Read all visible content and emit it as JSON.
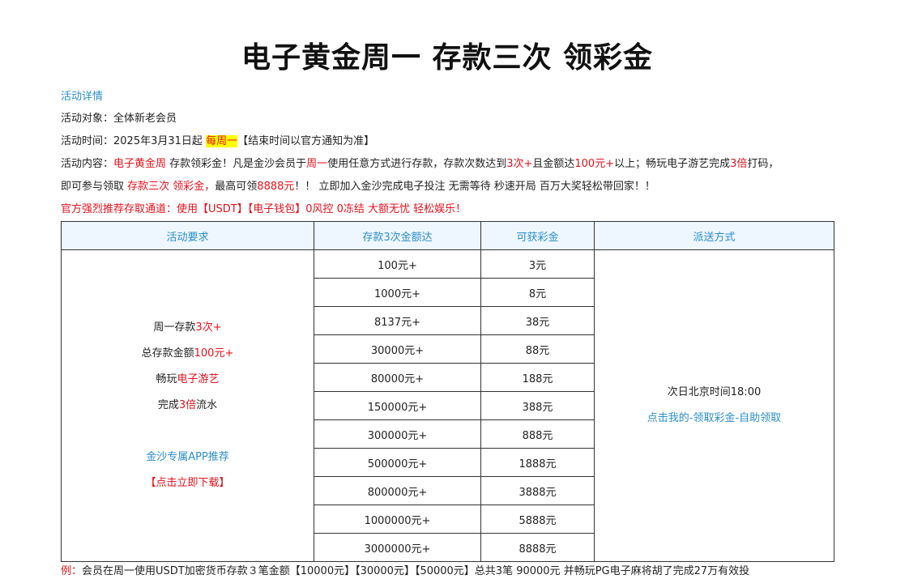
{
  "title": "电子黄金周一 存款三次 领彩金",
  "details_link": "活动详情",
  "target": {
    "label": "活动对象：",
    "value": "全体新老会员"
  },
  "time": {
    "label": "活动时间：",
    "start": "2025年3月31日起",
    "highlight": "每周一",
    "end": "【结束时间以官方通知为准】"
  },
  "content": {
    "label": "活动内容：",
    "r1": "电子黄金周",
    "t1": " 存款领彩金！凡是金沙会员于",
    "r2": "周一",
    "t2": "使用任意方式进行存款，存款次数达到",
    "r3": "3次+",
    "t3": "且金额达",
    "r4": "100元+",
    "t4": "以上；畅玩电子游艺完成",
    "r5": "3倍",
    "t5": "打码，",
    "l2_t1": "即可参与领取 ",
    "l2_r1": "存款三次 领彩金，",
    "l2_t2": "最高可领",
    "l2_r2": "8888元",
    "l2_t3": "！！ 立即加入金沙完成电子投注 无需等待 秒速开局 百万大奖轻松带回家！！"
  },
  "recommend": "官方强烈推荐存取通道：使用【USDT】【电子钱包】0风控 0冻结 大额无忧 轻松娱乐！",
  "table": {
    "headers": [
      "活动要求",
      "存款3次金额达",
      "可获彩金",
      "派送方式"
    ],
    "requirements": {
      "l1_t": "周一存款",
      "l1_r": "3次+",
      "l2_t": "总存款金额",
      "l2_r": "100元+",
      "l3_t": "畅玩",
      "l3_r": "电子游艺",
      "l4_t1": "完成",
      "l4_r": "3倍",
      "l4_t2": "流水",
      "app": "金沙专属APP推荐",
      "download": "【点击立即下载】"
    },
    "rows": [
      {
        "deposit": "100元+",
        "bonus": "3元"
      },
      {
        "deposit": "1000元+",
        "bonus": "8元"
      },
      {
        "deposit": "8137元+",
        "bonus": "38元"
      },
      {
        "deposit": "30000元+",
        "bonus": "88元"
      },
      {
        "deposit": "80000元+",
        "bonus": "188元"
      },
      {
        "deposit": "150000元+",
        "bonus": "388元"
      },
      {
        "deposit": "300000元+",
        "bonus": "888元"
      },
      {
        "deposit": "500000元+",
        "bonus": "1888元"
      },
      {
        "deposit": "800000元+",
        "bonus": "3888元"
      },
      {
        "deposit": "1000000元+",
        "bonus": "5888元"
      },
      {
        "deposit": "3000000元+",
        "bonus": "8888元"
      }
    ],
    "delivery": {
      "time": "次日北京时间18:00",
      "link": "点击我的-领取彩金-自助领取"
    }
  },
  "footnote": {
    "label": "例：",
    "text": "会员在周一使用USDT加密货币存款３笔金额【10000元】【30000元】【50000元】总共3笔 90000元 并畅玩PG电子麻将胡了完成27万有效投"
  }
}
